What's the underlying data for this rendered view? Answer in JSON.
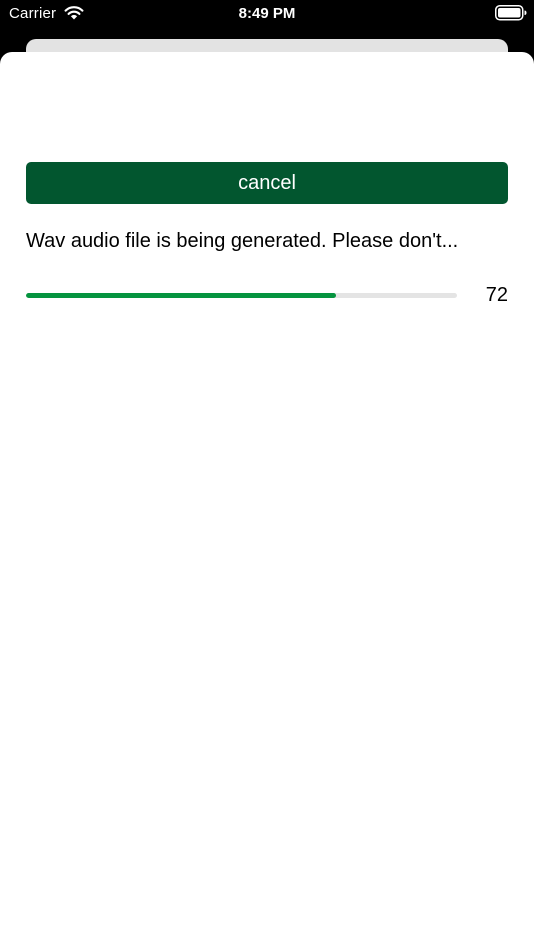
{
  "status_bar": {
    "carrier": "Carrier",
    "time": "8:49 PM",
    "wifi_icon": "wifi-icon",
    "battery_icon": "battery-full-icon"
  },
  "dialog": {
    "cancel_label": "cancel",
    "message": "Wav audio file is being generated. Please don't...",
    "progress_value": "72",
    "progress_fraction": 0.72
  },
  "colors": {
    "button_background": "#02562f",
    "progress_fill": "#05943f",
    "progress_track": "#e4e4e4"
  }
}
